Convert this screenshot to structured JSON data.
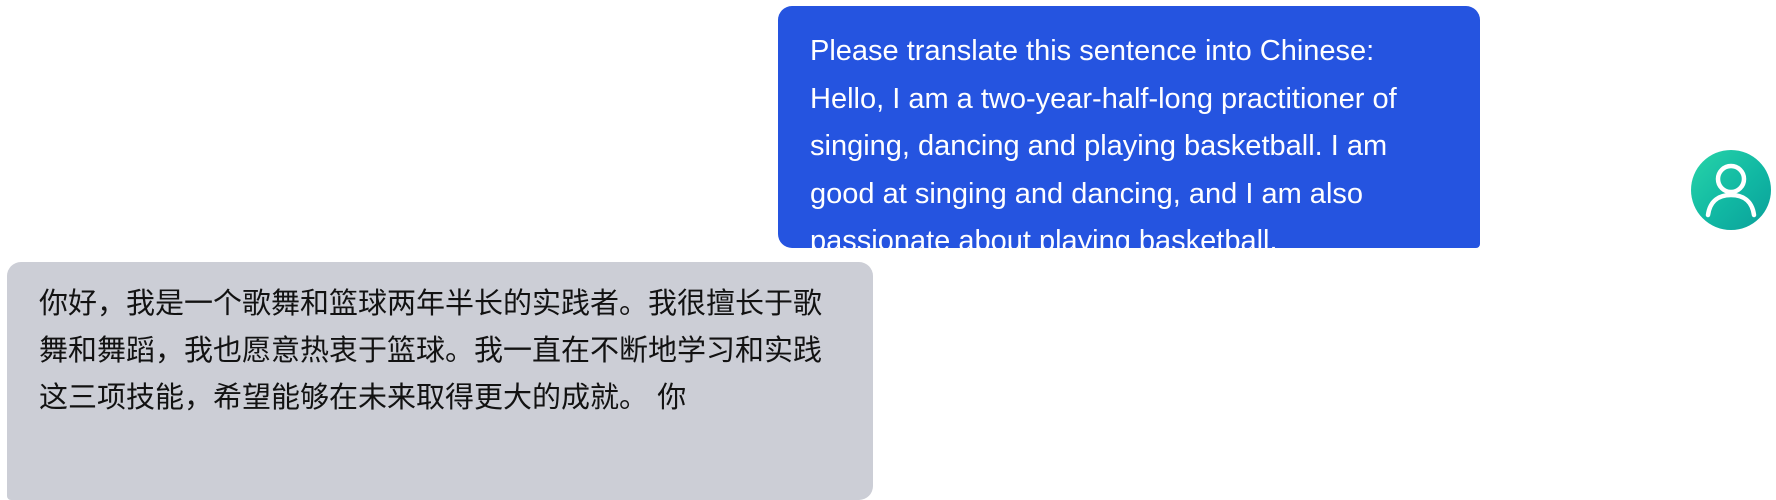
{
  "conversation": {
    "user_message": "Please translate this sentence into Chinese: Hello, I am a two-year-half-long practitioner of singing, dancing and playing basketball. I am good at singing and dancing, and I am also passionate about playing basketball.",
    "assistant_message": "你好，我是一个歌舞和篮球两年半长的实践者。我很擅长于歌舞和舞蹈，我也愿意热衷于篮球。我一直在不断地学习和实践这三项技能，希望能够在未来取得更大的成就。 你",
    "user_avatar_icon": "user-avatar-icon"
  },
  "colors": {
    "user_bubble": "#2554e0",
    "assistant_bubble": "#ccced6",
    "avatar_start": "#28d4a8",
    "avatar_end": "#0aa09a"
  }
}
